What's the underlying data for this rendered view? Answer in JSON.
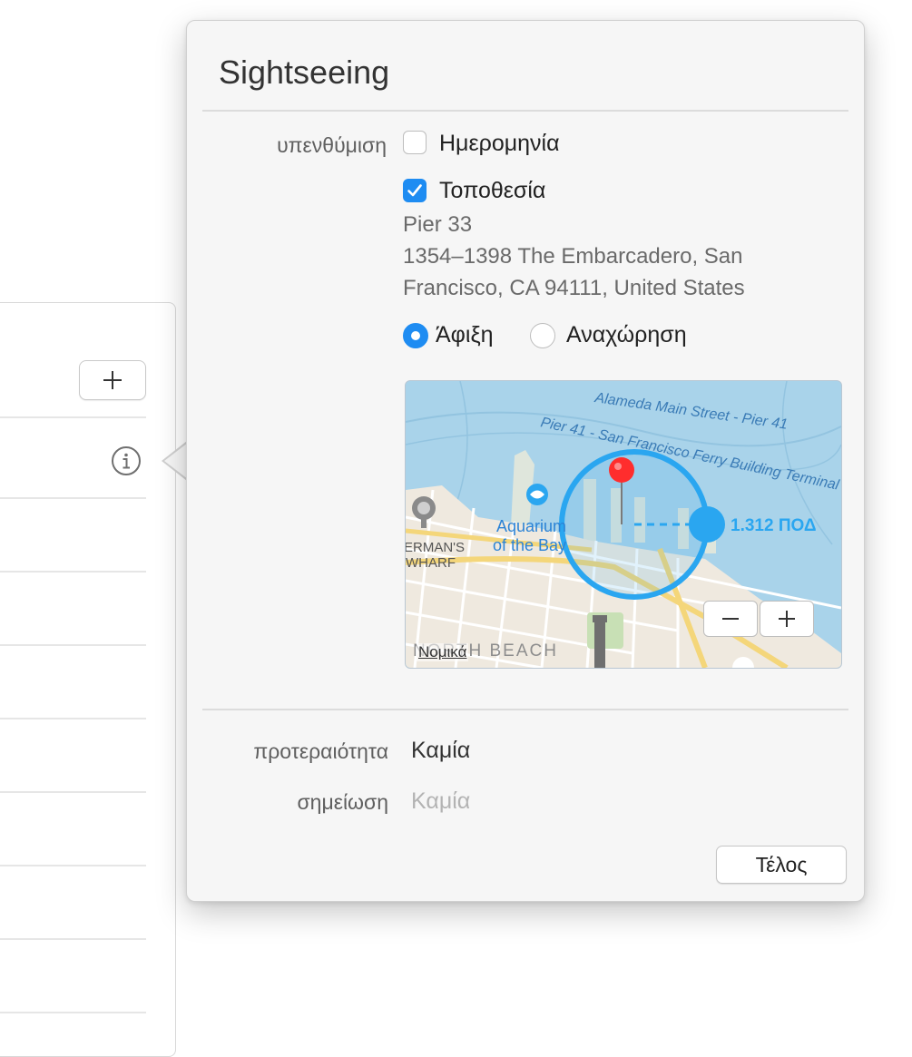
{
  "popover": {
    "title": "Sightseeing",
    "reminder": {
      "label": "υπενθύμιση",
      "date_label": "Ημερομηνία",
      "date_checked": false,
      "location_label": "Τοποθεσία",
      "location_checked": true,
      "address": [
        "Pier 33",
        "1354–1398 The Embarcadero, San",
        "Francisco, CA  94111, United States"
      ],
      "arriving_label": "Άφιξη",
      "leaving_label": "Αναχώρηση",
      "selected": "arriving"
    },
    "map": {
      "street_label_1": "Alameda Main Street - Pier 41",
      "street_label_2": "Pier 41 - San Francisco Ferry Building Terminal",
      "poi_label": "Aquarium of the Bay",
      "poi_line1": "Aquarium",
      "poi_line2": "of the Bay",
      "district_line1": "ERMAN'S",
      "district_line2": "WHARF",
      "neighborhood": "NORTH BEACH",
      "legal_link": "Νομικά",
      "radius_label": "1.312 ΠΟΔ",
      "radius_value_feet": 1312
    },
    "priority": {
      "label": "προτεραιότητα",
      "value": "Καμία"
    },
    "note": {
      "label": "σημείωση",
      "placeholder": "Καμία"
    },
    "done_label": "Τέλος"
  },
  "colors": {
    "accent": "#1e8cf2",
    "geofence": "#2aa6f0",
    "water": "#a9d3ea",
    "popover_bg": "#f6f6f6"
  },
  "icons": {
    "add": "plus-icon",
    "info": "info-icon",
    "pin": "map-pin-icon",
    "zoom_out": "minus-icon",
    "zoom_in": "plus-icon"
  }
}
